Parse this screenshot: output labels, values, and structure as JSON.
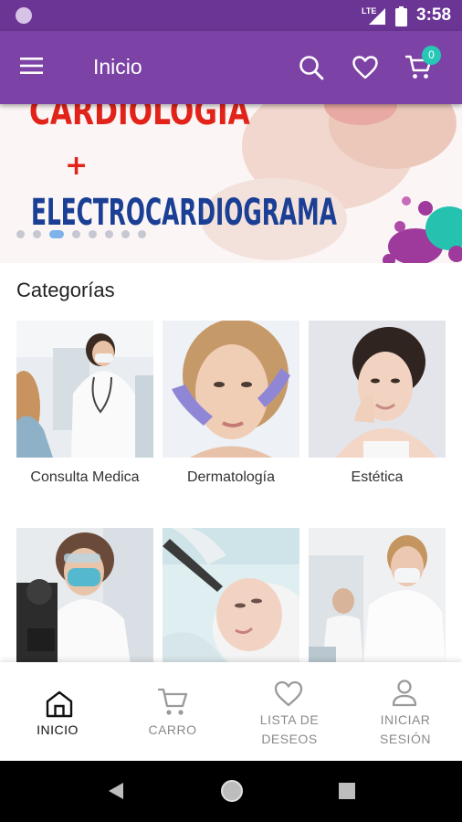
{
  "status_bar": {
    "network": "LTE",
    "time": "3:58"
  },
  "app_bar": {
    "title": "Inicio",
    "cart_count": "0",
    "icons": [
      "menu-icon",
      "search-icon",
      "heart-icon",
      "cart-icon"
    ]
  },
  "banner": {
    "line1": "CARDIOLOGIA",
    "plus": "+",
    "line2": "ELECTROCARDIOGRAMA",
    "page_count": 8,
    "active_page": 2
  },
  "categories": {
    "title": "Categorías",
    "items": [
      {
        "label": "Consulta Medica"
      },
      {
        "label": "Dermatología"
      },
      {
        "label": "Estética"
      },
      {
        "label": ""
      },
      {
        "label": ""
      },
      {
        "label": ""
      }
    ]
  },
  "bottom_nav": {
    "items": [
      {
        "label": "INICIO",
        "icon": "home-icon",
        "active": true
      },
      {
        "label": "CARRO",
        "icon": "cart-icon",
        "active": false
      },
      {
        "label": "LISTA DE DESEOS",
        "icon": "heart-icon",
        "active": false
      },
      {
        "label": "INICIAR SESIÓN",
        "icon": "user-icon",
        "active": false
      }
    ]
  },
  "colors": {
    "status_bar": "#6b3595",
    "app_bar": "#7c42a6",
    "badge": "#27c7b6",
    "banner_red": "#e2231a",
    "banner_blue": "#1a3f94"
  }
}
